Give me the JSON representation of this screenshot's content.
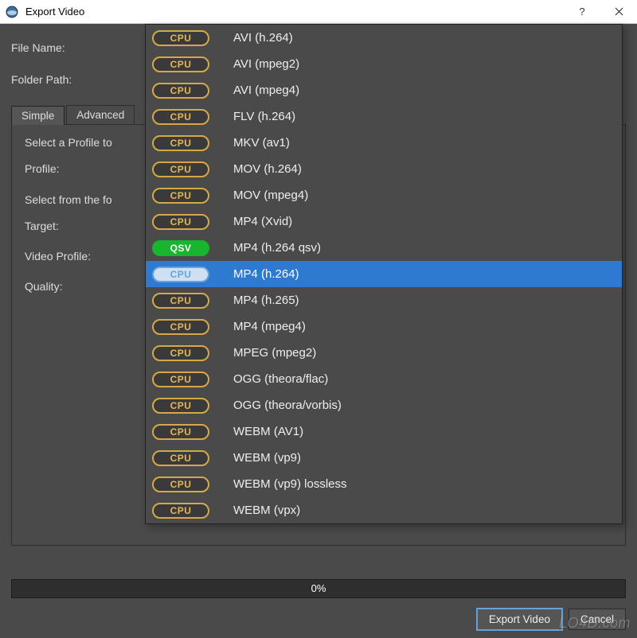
{
  "window": {
    "title": "Export Video",
    "help": "?",
    "close": "×"
  },
  "fields": {
    "file_name_label": "File Name:",
    "folder_path_label": "Folder Path:"
  },
  "tabs": {
    "simple": "Simple",
    "advanced": "Advanced"
  },
  "profile_section": {
    "heading_line": "Select a Profile to",
    "profile_label": "Profile:",
    "select_from_line": "Select from the fo",
    "target_label": "Target:",
    "video_profile_label": "Video Profile:",
    "quality_label": "Quality:"
  },
  "progress": {
    "text": "0%"
  },
  "buttons": {
    "export": "Export Video",
    "cancel": "Cancel"
  },
  "dropdown": {
    "options": [
      {
        "badge": "CPU",
        "badge_kind": "cpu",
        "label": "AVI (h.264)",
        "selected": false
      },
      {
        "badge": "CPU",
        "badge_kind": "cpu",
        "label": "AVI (mpeg2)",
        "selected": false
      },
      {
        "badge": "CPU",
        "badge_kind": "cpu",
        "label": "AVI (mpeg4)",
        "selected": false
      },
      {
        "badge": "CPU",
        "badge_kind": "cpu",
        "label": "FLV (h.264)",
        "selected": false
      },
      {
        "badge": "CPU",
        "badge_kind": "cpu",
        "label": "MKV (av1)",
        "selected": false
      },
      {
        "badge": "CPU",
        "badge_kind": "cpu",
        "label": "MOV (h.264)",
        "selected": false
      },
      {
        "badge": "CPU",
        "badge_kind": "cpu",
        "label": "MOV (mpeg4)",
        "selected": false
      },
      {
        "badge": "CPU",
        "badge_kind": "cpu",
        "label": "MP4 (Xvid)",
        "selected": false
      },
      {
        "badge": "QSV",
        "badge_kind": "qsv",
        "label": "MP4 (h.264 qsv)",
        "selected": false
      },
      {
        "badge": "CPU",
        "badge_kind": "cpu-sel",
        "label": "MP4 (h.264)",
        "selected": true
      },
      {
        "badge": "CPU",
        "badge_kind": "cpu",
        "label": "MP4 (h.265)",
        "selected": false
      },
      {
        "badge": "CPU",
        "badge_kind": "cpu",
        "label": "MP4 (mpeg4)",
        "selected": false
      },
      {
        "badge": "CPU",
        "badge_kind": "cpu",
        "label": "MPEG (mpeg2)",
        "selected": false
      },
      {
        "badge": "CPU",
        "badge_kind": "cpu",
        "label": "OGG (theora/flac)",
        "selected": false
      },
      {
        "badge": "CPU",
        "badge_kind": "cpu",
        "label": "OGG (theora/vorbis)",
        "selected": false
      },
      {
        "badge": "CPU",
        "badge_kind": "cpu",
        "label": "WEBM (AV1)",
        "selected": false
      },
      {
        "badge": "CPU",
        "badge_kind": "cpu",
        "label": "WEBM (vp9)",
        "selected": false
      },
      {
        "badge": "CPU",
        "badge_kind": "cpu",
        "label": "WEBM (vp9) lossless",
        "selected": false
      },
      {
        "badge": "CPU",
        "badge_kind": "cpu",
        "label": "WEBM (vpx)",
        "selected": false
      }
    ]
  },
  "watermark": "LO4D.com"
}
